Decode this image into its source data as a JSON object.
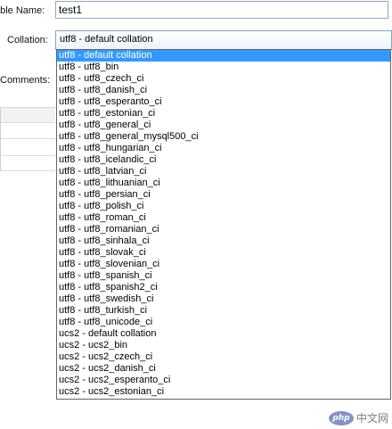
{
  "form": {
    "table_name_label": "able Name:",
    "table_name_value": "test1",
    "collation_label": "Collation:",
    "collation_selected": "utf8 - default collation",
    "comments_label": "Comments:"
  },
  "dropdown": {
    "selected_index": 0,
    "options": [
      "utf8 - default collation",
      "utf8 - utf8_bin",
      "utf8 - utf8_czech_ci",
      "utf8 - utf8_danish_ci",
      "utf8 - utf8_esperanto_ci",
      "utf8 - utf8_estonian_ci",
      "utf8 - utf8_general_ci",
      "utf8 - utf8_general_mysql500_ci",
      "utf8 - utf8_hungarian_ci",
      "utf8 - utf8_icelandic_ci",
      "utf8 - utf8_latvian_ci",
      "utf8 - utf8_lithuanian_ci",
      "utf8 - utf8_persian_ci",
      "utf8 - utf8_polish_ci",
      "utf8 - utf8_roman_ci",
      "utf8 - utf8_romanian_ci",
      "utf8 - utf8_sinhala_ci",
      "utf8 - utf8_slovak_ci",
      "utf8 - utf8_slovenian_ci",
      "utf8 - utf8_spanish_ci",
      "utf8 - utf8_spanish2_ci",
      "utf8 - utf8_swedish_ci",
      "utf8 - utf8_turkish_ci",
      "utf8 - utf8_unicode_ci",
      "ucs2 - default collation",
      "ucs2 - ucs2_bin",
      "ucs2 - ucs2_czech_ci",
      "ucs2 - ucs2_danish_ci",
      "ucs2 - ucs2_esperanto_ci",
      "ucs2 - ucs2_estonian_ci"
    ]
  },
  "watermark": {
    "logo_text": "php",
    "site_text": "中文网"
  },
  "colors": {
    "selection": "#3399ff",
    "dropdown_border": "#646464"
  }
}
